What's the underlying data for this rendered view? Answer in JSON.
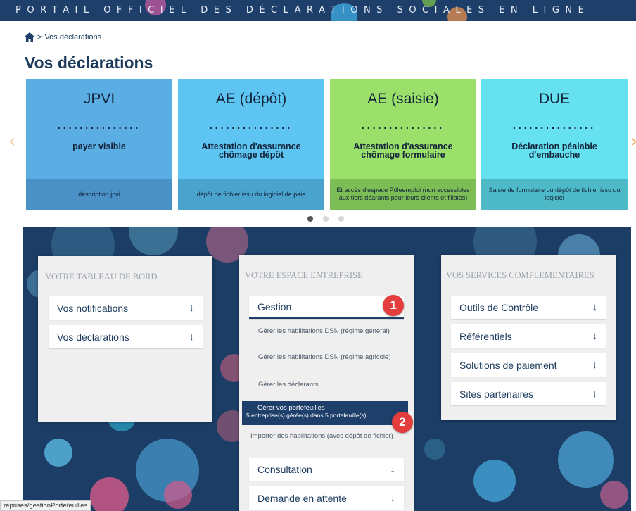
{
  "header": {
    "banner_text": "PORTAIL OFFICIEL DES DÉCLARATIONS SOCIALES EN LIGNE"
  },
  "breadcrumb": {
    "home_icon": "home-icon",
    "separator": ">",
    "current": "Vos déclarations"
  },
  "page_title": "Vos déclarations",
  "carousel": {
    "cards": [
      {
        "title": "JPVI",
        "dots": "...............",
        "subtitle": "payer visible",
        "footer": "description jpvi",
        "color": "#5aaee4",
        "foot_color": "#4a91c6"
      },
      {
        "title": "AE (dépôt)",
        "dots": "...............",
        "subtitle": "Attestation d'assurance chômage dépôt",
        "footer": "dépôt de fichier issu du logiciel de paie",
        "color": "#5ec5f2",
        "foot_color": "#4aa3cc"
      },
      {
        "title": "AE (saisie)",
        "dots": "...............",
        "subtitle": "Attestation d'assurance chômage formulaire",
        "footer": "Et accès d'espace Pôleemploi (non accessibles aux tiers déarants pour leurs clients et filiales)",
        "color": "#9be06a",
        "foot_color": "#7cbd55"
      },
      {
        "title": "DUE",
        "dots": "...............",
        "subtitle": "Déclaration péalable d'embauche",
        "footer": "Saisie de formulaire ou dépôt de fichier issu du logiciel",
        "color": "#65e1ef",
        "foot_color": "#4fbac7"
      }
    ],
    "prev_icon": "chevron-left-icon",
    "next_icon": "chevron-right-icon"
  },
  "dashboard": {
    "heading": "VOTRE TABLEAU DE BORD",
    "items": [
      {
        "label": "Vos notifications",
        "arrow": "↓"
      },
      {
        "label": "Vos déclarations",
        "arrow": "↓"
      }
    ]
  },
  "enterprise": {
    "heading": "VOTRE ESPACE ENTREPRISE",
    "gestion_label": "Gestion",
    "links": [
      "Gérer les habilitations DSN (régime général)",
      "Gérer les habilitations DSN (régime agricole)",
      "Gérer les déclarants"
    ],
    "highlight_title": "Gérer vos portefeuilles",
    "highlight_sub": "5 entreprise(s) gérée(s) dans 5 portefeuille(s)",
    "import_link": "Importer des habilitations (avec dépôt de fichier)",
    "items": [
      {
        "label": "Consultation",
        "arrow": "↓"
      },
      {
        "label": "Demande en attente",
        "arrow": "↓"
      }
    ]
  },
  "services": {
    "heading": "VOS SERVICES COMPLEMENTAIRES",
    "items": [
      {
        "label": "Outils de Contrôle",
        "arrow": "↓"
      },
      {
        "label": "Référentiels",
        "arrow": "↓"
      },
      {
        "label": "Solutions de paiement",
        "arrow": "↓"
      },
      {
        "label": "Sites partenaires",
        "arrow": "↓"
      }
    ]
  },
  "badges": {
    "one": "1",
    "two": "2"
  },
  "status_url": "reprises/gestionPortefeuilles"
}
